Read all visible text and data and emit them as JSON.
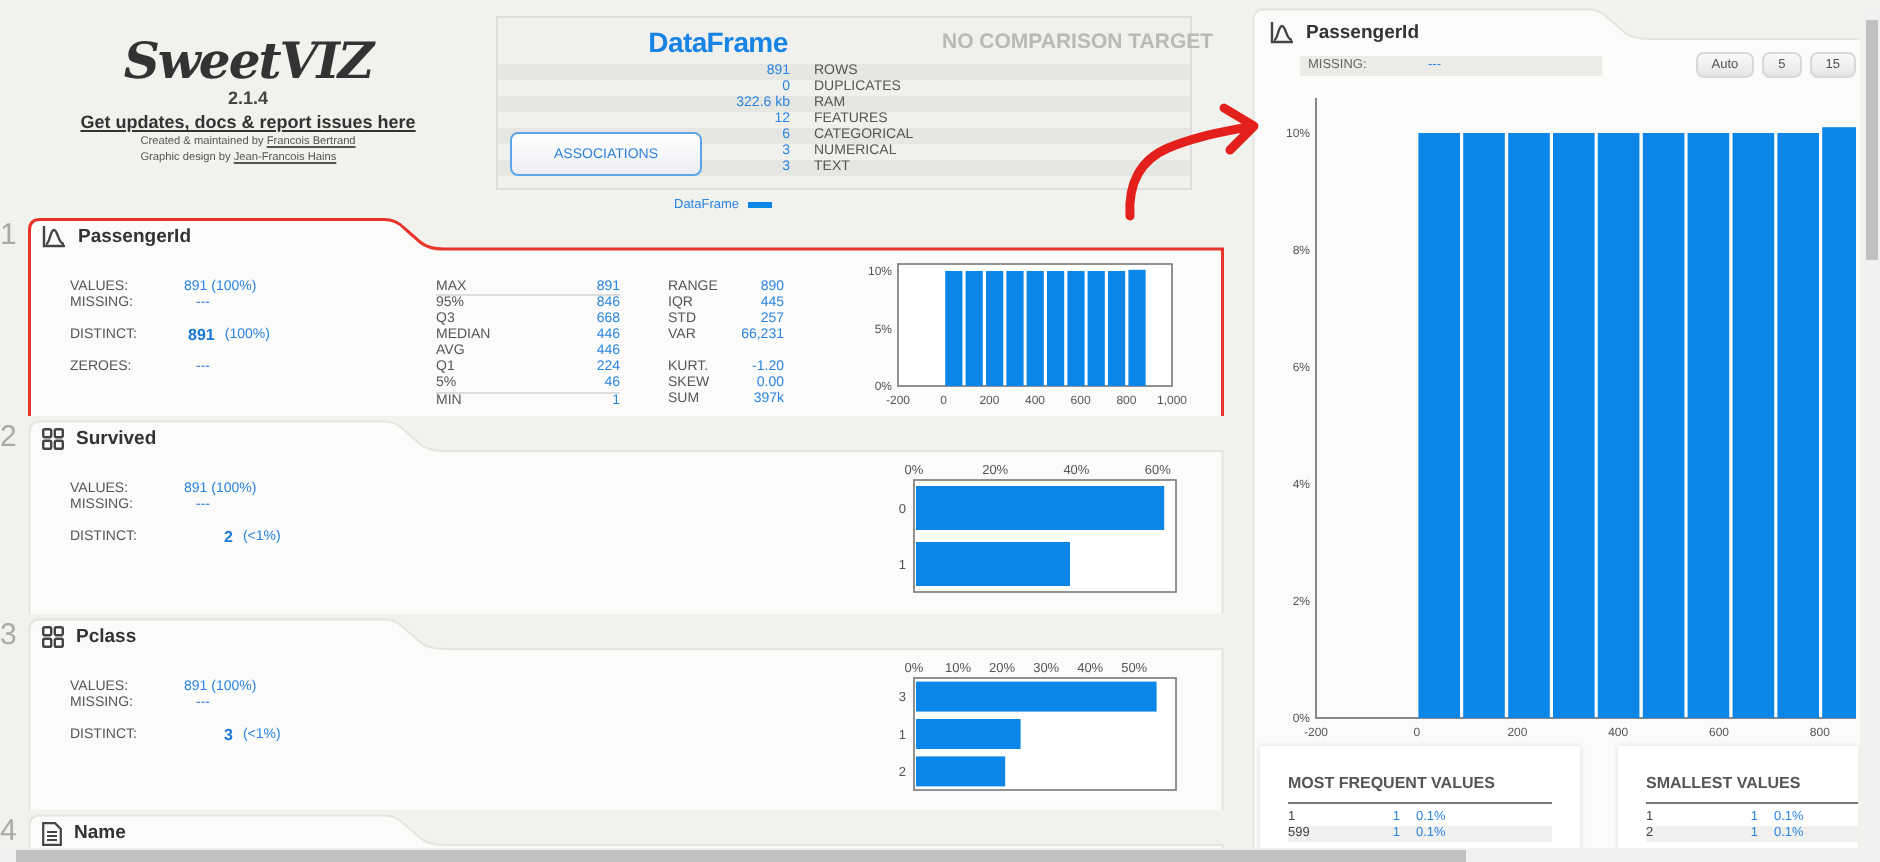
{
  "report": {
    "logo": "SweetVIZ",
    "version": "2.1.4",
    "link": "Get updates, docs & report issues here",
    "credits": [
      {
        "text": "Created & maintained by",
        "link": "Francois Bertrand"
      },
      {
        "text": "Graphic design by",
        "link": "Jean-Francois Hains"
      }
    ]
  },
  "summary": {
    "title": "DataFrame",
    "compare_title": "NO COMPARISON TARGET",
    "stats": [
      {
        "value": "891",
        "label": "ROWS"
      },
      {
        "value": "0",
        "label": "DUPLICATES"
      },
      {
        "value": "322.6 kb",
        "label": "RAM"
      },
      {
        "value": "12",
        "label": "FEATURES"
      },
      {
        "value": "6",
        "label": "CATEGORICAL"
      },
      {
        "value": "3",
        "label": "NUMERICAL"
      },
      {
        "value": "3",
        "label": "TEXT"
      }
    ],
    "button": "ASSOCIATIONS",
    "legend": "DataFrame"
  },
  "features": [
    {
      "index": "1",
      "name": "PassengerId",
      "kind": "numeric",
      "selected": true,
      "overview": [
        {
          "kind": "plain",
          "label": "VALUES:",
          "value": "891 (100%)"
        },
        {
          "kind": "plain",
          "label": "MISSING:",
          "value": "---"
        },
        {
          "kind": "distinct",
          "label": "DISTINCT:",
          "value": "891",
          "pct": "(100%)"
        },
        {
          "kind": "plain",
          "label": "ZEROES:",
          "value": "---"
        }
      ],
      "quantiles": [
        {
          "label": "MAX",
          "value": "891"
        },
        {
          "label": "95%",
          "value": "846"
        },
        {
          "label": "Q3",
          "value": "668"
        },
        {
          "label": "MEDIAN",
          "value": "446"
        },
        {
          "label": "AVG",
          "value": "446"
        },
        {
          "label": "Q1",
          "value": "224"
        },
        {
          "label": "5%",
          "value": "46"
        },
        {
          "label": "MIN",
          "value": "1"
        }
      ],
      "spread": [
        {
          "label": "RANGE",
          "value": "890"
        },
        {
          "label": "IQR",
          "value": "445"
        },
        {
          "label": "STD",
          "value": "257"
        },
        {
          "label": "VAR",
          "value": "66,231"
        }
      ],
      "shape": [
        {
          "label": "KURT.",
          "value": "-1.20"
        },
        {
          "label": "SKEW",
          "value": "0.00"
        },
        {
          "label": "SUM",
          "value": "397k"
        }
      ],
      "chart_data": {
        "type": "bar",
        "x": [
          44.55,
          133.65,
          222.75,
          311.85,
          400.95,
          490.05,
          579.15,
          668.25,
          757.35,
          846.45
        ],
        "series": [
          {
            "color": "#0a86e8",
            "values": [
              10,
              10,
              10,
              10,
              10,
              10,
              10,
              10,
              10,
              10.1
            ]
          }
        ],
        "xlim": [
          -200,
          1000
        ],
        "ylim": [
          0,
          10.6
        ],
        "xticks": [
          {
            "value": -200,
            "label": "-200"
          },
          {
            "value": 0,
            "label": "0"
          },
          {
            "value": 200,
            "label": "200"
          },
          {
            "value": 400,
            "label": "400"
          },
          {
            "value": 600,
            "label": "600"
          },
          {
            "value": 800,
            "label": "800"
          },
          {
            "value": 1000,
            "label": "1,000"
          }
        ],
        "yticks": [
          {
            "value": 0,
            "label": "0%"
          },
          {
            "value": 5,
            "label": "5%"
          },
          {
            "value": 10,
            "label": "10%"
          }
        ]
      }
    },
    {
      "index": "2",
      "name": "Survived",
      "kind": "categorical",
      "selected": false,
      "overview": [
        {
          "kind": "plain",
          "label": "VALUES:",
          "value": "891 (100%)"
        },
        {
          "kind": "plain",
          "label": "MISSING:",
          "value": "---"
        },
        {
          "kind": "distinct",
          "label": "DISTINCT:",
          "value": "2",
          "pct": "(<1%)"
        }
      ],
      "chart_data": {
        "type": "bar",
        "orientation": "horizontal",
        "categories": [
          "0",
          "1"
        ],
        "series": [
          {
            "color": "#0a86e8",
            "values": [
              61.6,
              38.4
            ]
          }
        ],
        "xlim": [
          0,
          64.5
        ],
        "xticks": [
          {
            "value": 0,
            "label": "0%"
          },
          {
            "value": 20,
            "label": "20%"
          },
          {
            "value": 40,
            "label": "40%"
          },
          {
            "value": 60,
            "label": "60%"
          }
        ]
      }
    },
    {
      "index": "3",
      "name": "Pclass",
      "kind": "categorical",
      "selected": false,
      "overview": [
        {
          "kind": "plain",
          "label": "VALUES:",
          "value": "891 (100%)"
        },
        {
          "kind": "plain",
          "label": "MISSING:",
          "value": "---"
        },
        {
          "kind": "distinct",
          "label": "DISTINCT:",
          "value": "3",
          "pct": "(<1%)"
        }
      ],
      "chart_data": {
        "type": "bar",
        "orientation": "horizontal",
        "categories": [
          "3",
          "1",
          "2"
        ],
        "series": [
          {
            "color": "#0a86e8",
            "values": [
              55.1,
              24.2,
              20.7
            ]
          }
        ],
        "xlim": [
          0,
          59.5
        ],
        "xticks": [
          {
            "value": 0,
            "label": "0%"
          },
          {
            "value": 10,
            "label": "10%"
          },
          {
            "value": 20,
            "label": "20%"
          },
          {
            "value": 30,
            "label": "30%"
          },
          {
            "value": 40,
            "label": "40%"
          },
          {
            "value": 50,
            "label": "50%"
          }
        ]
      }
    },
    {
      "index": "4",
      "name": "Name",
      "kind": "text",
      "selected": false
    }
  ],
  "detail": {
    "name": "PassengerId",
    "kind": "numeric",
    "missing_label": "MISSING:",
    "missing": "---",
    "bin_buttons": [
      "Auto",
      "5",
      "15"
    ],
    "chart_data": {
      "type": "bar",
      "x": [
        44.55,
        133.65,
        222.75,
        311.85,
        400.95,
        490.05,
        579.15,
        668.25,
        757.35,
        846.45
      ],
      "series": [
        {
          "color": "#0a86e8",
          "values": [
            10,
            10,
            10,
            10,
            10,
            10,
            10,
            10,
            10,
            10.1
          ]
        }
      ],
      "xlim": [
        -200,
        872
      ],
      "ylim": [
        0,
        10.6
      ],
      "xticks": [
        {
          "value": -200,
          "label": "-200"
        },
        {
          "value": 0,
          "label": "0"
        },
        {
          "value": 200,
          "label": "200"
        },
        {
          "value": 400,
          "label": "400"
        },
        {
          "value": 600,
          "label": "600"
        },
        {
          "value": 800,
          "label": "800"
        }
      ],
      "yticks": [
        {
          "value": 0,
          "label": "0%"
        },
        {
          "value": 2,
          "label": "2%"
        },
        {
          "value": 4,
          "label": "4%"
        },
        {
          "value": 6,
          "label": "6%"
        },
        {
          "value": 8,
          "label": "8%"
        },
        {
          "value": 10,
          "label": "10%"
        }
      ]
    },
    "tables": [
      {
        "title": "MOST FREQUENT VALUES",
        "rows": [
          [
            "1",
            "1",
            "0.1%"
          ],
          [
            "599",
            "1",
            "0.1%"
          ]
        ]
      },
      {
        "title": "SMALLEST VALUES",
        "rows": [
          [
            "1",
            "1",
            "0.1%"
          ],
          [
            "2",
            "1",
            "0.1%"
          ]
        ]
      }
    ]
  },
  "annotations": [
    {
      "kind": "arrow"
    }
  ]
}
